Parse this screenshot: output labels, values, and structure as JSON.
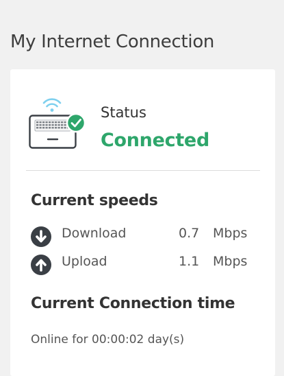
{
  "page": {
    "title": "My Internet Connection"
  },
  "status": {
    "label": "Status",
    "value": "Connected",
    "color": "#2ea66b",
    "icon": "laptop-wifi-connected-icon"
  },
  "speeds": {
    "heading": "Current speeds",
    "download": {
      "label": "Download",
      "value": "0.7",
      "unit": "Mbps",
      "icon": "download-arrow-icon"
    },
    "upload": {
      "label": "Upload",
      "value": "1.1",
      "unit": "Mbps",
      "icon": "upload-arrow-icon"
    }
  },
  "connection_time": {
    "heading": "Current Connection time",
    "text": "Online for 00:00:02 day(s)"
  },
  "colors": {
    "accent_green": "#2ea66b",
    "icon_dark": "#3a3f45",
    "wifi_blue": "#7fd0ee"
  }
}
